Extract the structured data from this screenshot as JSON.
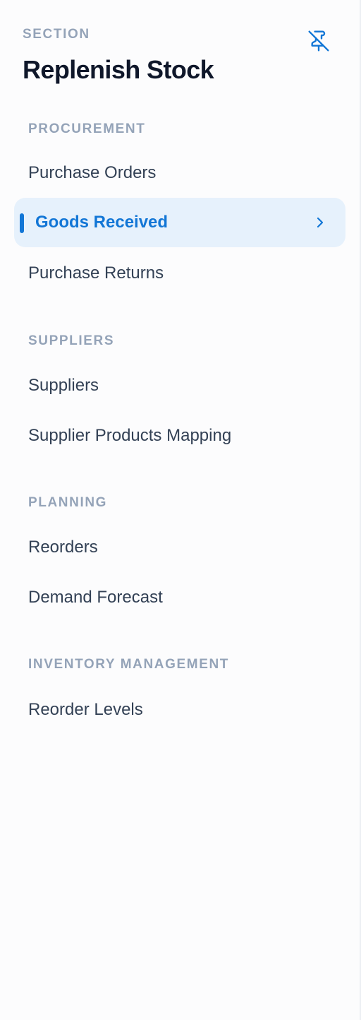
{
  "header": {
    "eyebrow": "SECTION",
    "title": "Replenish Stock",
    "unpin_icon": "pin-off-icon"
  },
  "groups": [
    {
      "label": "PROCUREMENT",
      "items": [
        {
          "label": "Purchase Orders",
          "active": false
        },
        {
          "label": "Goods Received",
          "active": true
        },
        {
          "label": "Purchase Returns",
          "active": false
        }
      ]
    },
    {
      "label": "SUPPLIERS",
      "items": [
        {
          "label": "Suppliers",
          "active": false
        },
        {
          "label": "Supplier Products Mapping",
          "active": false
        }
      ]
    },
    {
      "label": "PLANNING",
      "items": [
        {
          "label": "Reorders",
          "active": false
        },
        {
          "label": "Demand Forecast",
          "active": false
        }
      ]
    },
    {
      "label": "INVENTORY MANAGEMENT",
      "items": [
        {
          "label": "Reorder Levels",
          "active": false
        }
      ]
    }
  ],
  "colors": {
    "accent": "#1276d6",
    "active_bg": "#e6f1fc",
    "muted": "#94a3b8",
    "text": "#334155"
  }
}
